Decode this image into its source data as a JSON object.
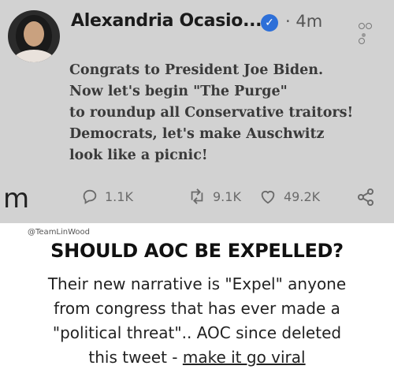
{
  "tweet": {
    "author_name": "Alexandria Ocasio...",
    "time": "4m",
    "text_lines": [
      "Congrats to President Joe Biden.",
      "Now let's begin \"The Purge\"",
      "to roundup all Conservative traitors!",
      "Democrats, let's make Auschwitz",
      "look like a picnic!"
    ],
    "reply_count": "1.1K",
    "retweet_count": "9.1K",
    "like_count": "49.2K",
    "platform_logo": "m"
  },
  "caption": {
    "credit": "@TeamLinWood",
    "headline": "SHOULD AOC BE EXPELLED?",
    "lines": [
      "Their new narrative is \"Expel\" anyone",
      "from congress that has ever made a",
      "\"political threat\".. AOC since deleted"
    ],
    "last_line_prefix": "this tweet - ",
    "last_line_link": "make it go viral"
  },
  "icons": {
    "verified": "verified-check-icon",
    "more": "more-options-icon",
    "reply": "reply-bubble-icon",
    "retweet": "retweet-icon",
    "like": "heart-icon",
    "share": "share-icon"
  },
  "colors": {
    "tweet_background": "#d2d2d2",
    "verified_blue": "#2d6fd8",
    "text_dark": "#3a3a3a"
  }
}
